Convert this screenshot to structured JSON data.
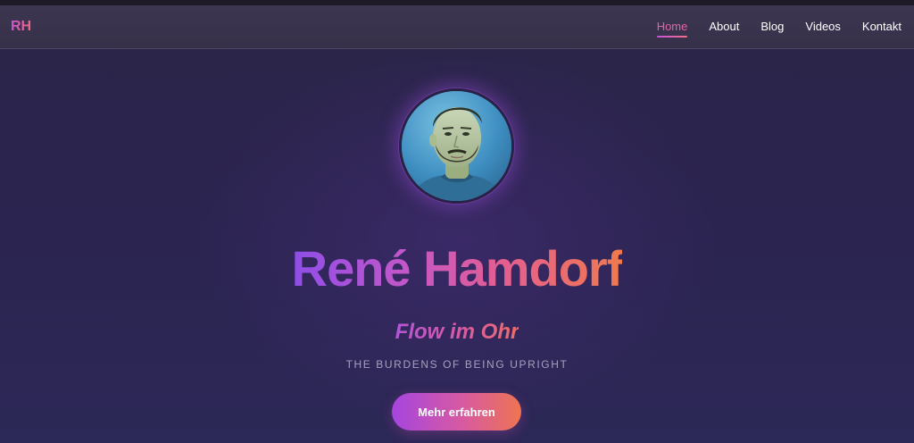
{
  "header": {
    "logo": "RH",
    "nav": [
      {
        "label": "Home",
        "active": true
      },
      {
        "label": "About",
        "active": false
      },
      {
        "label": "Blog",
        "active": false
      },
      {
        "label": "Videos",
        "active": false
      },
      {
        "label": "Kontakt",
        "active": false
      }
    ]
  },
  "hero": {
    "name": "René Hamdorf",
    "subtitle": "Flow im Ohr",
    "tagline": "THE BURDENS OF BEING UPRIGHT",
    "cta_label": "Mehr erfahren"
  },
  "colors": {
    "background": "#2a2447",
    "navbar": "#3a344f",
    "accent_start": "#8e4ee8",
    "accent_mid": "#e55f8e",
    "accent_end": "#f07a4d",
    "tagline": "#a7a0bf"
  }
}
